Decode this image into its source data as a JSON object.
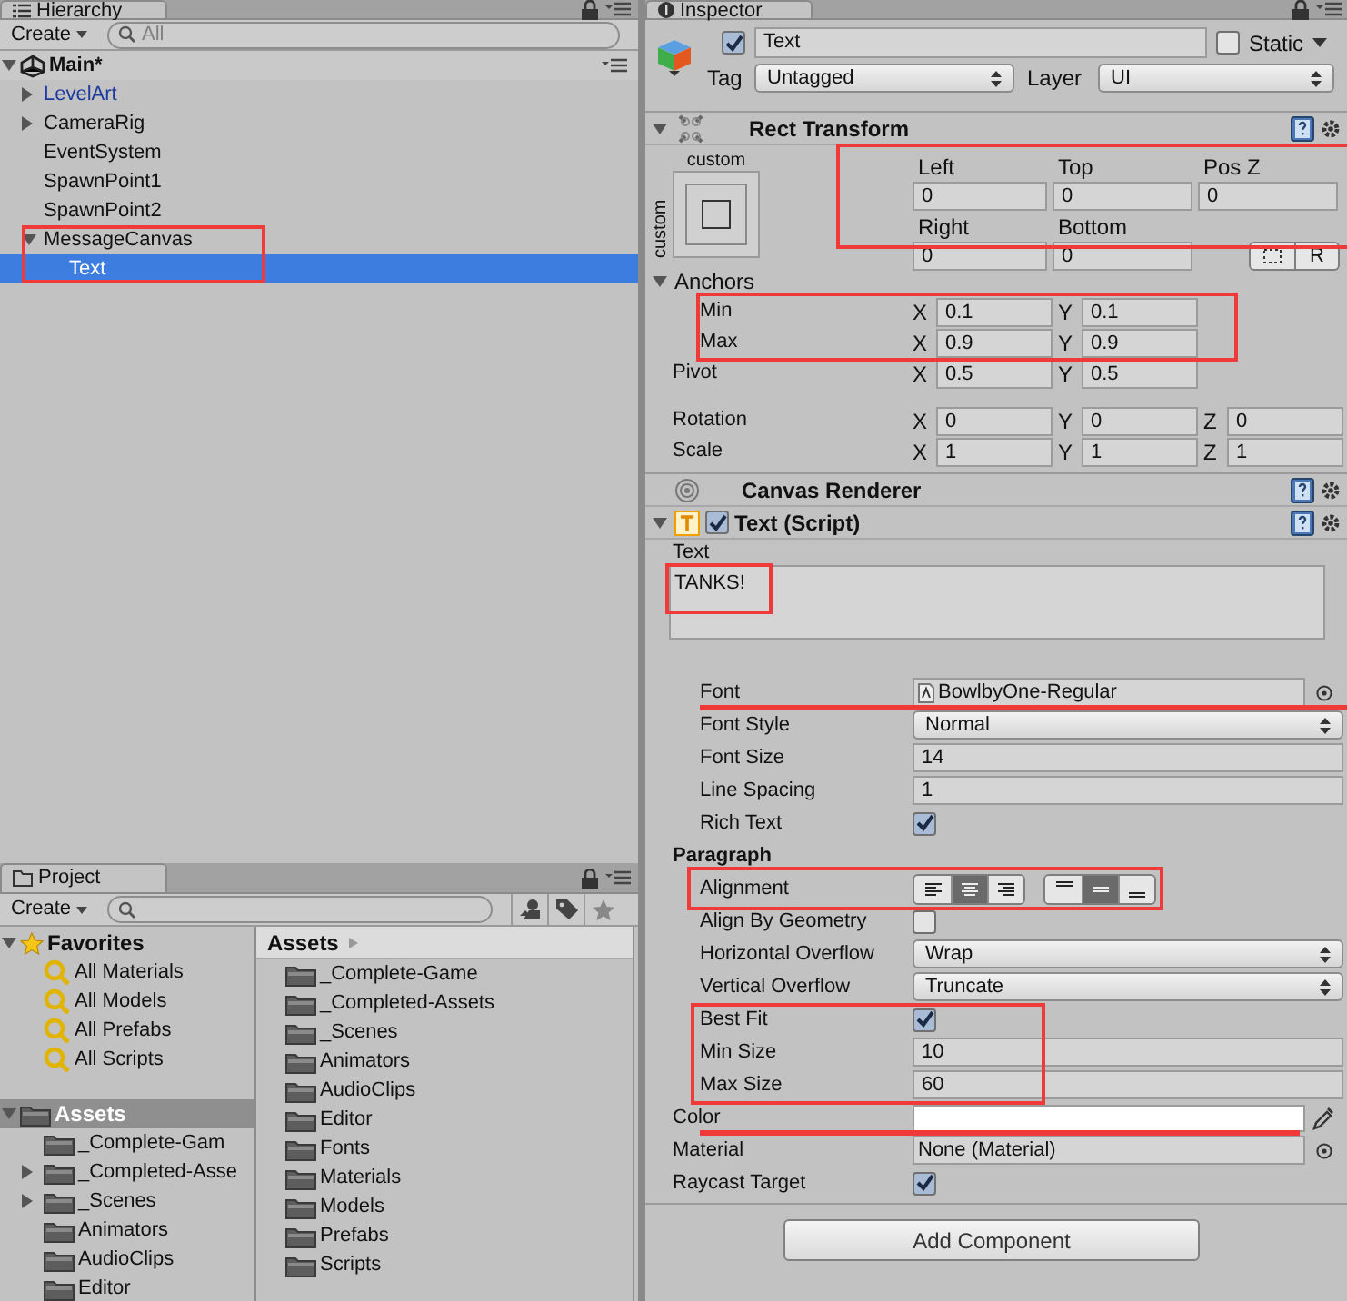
{
  "hierarchy": {
    "tab": "Hierarchy",
    "create": "Create",
    "search_placeholder": "All",
    "scene": {
      "name": "Main*",
      "expanded": true
    },
    "items": [
      {
        "label": "LevelArt",
        "prefab": true,
        "expanded": false,
        "selected": false
      },
      {
        "label": "CameraRig",
        "prefab": false,
        "expanded": false,
        "selected": false
      },
      {
        "label": "EventSystem",
        "prefab": false,
        "selected": false
      },
      {
        "label": "SpawnPoint1",
        "prefab": false,
        "selected": false
      },
      {
        "label": "SpawnPoint2",
        "prefab": false,
        "selected": false
      },
      {
        "label": "MessageCanvas",
        "prefab": false,
        "expanded": true,
        "selected": false,
        "highlighted": true,
        "children": [
          {
            "label": "Text",
            "prefab": false,
            "selected": true
          }
        ]
      }
    ]
  },
  "project": {
    "tab": "Project",
    "create": "Create",
    "favorites": {
      "label": "Favorites",
      "expanded": true,
      "items": [
        "All Materials",
        "All Models",
        "All Prefabs",
        "All Scripts"
      ]
    },
    "assets_tree": {
      "label": "Assets",
      "expanded": true,
      "selected": true,
      "children": [
        {
          "label": "_Complete-Gam"
        },
        {
          "label": "_Completed-Asse",
          "expanded": false
        },
        {
          "label": "_Scenes",
          "expanded": false
        },
        {
          "label": "Animators"
        },
        {
          "label": "AudioClips"
        },
        {
          "label": "Editor"
        }
      ]
    },
    "breadcrumb": "Assets",
    "folders": [
      "_Complete-Game",
      "_Completed-Assets",
      "_Scenes",
      "Animators",
      "AudioClips",
      "Editor",
      "Fonts",
      "Materials",
      "Models",
      "Prefabs",
      "Scripts"
    ]
  },
  "inspector": {
    "tab": "Inspector",
    "active": true,
    "name": "Text",
    "static": false,
    "static_label": "Static",
    "tag_label": "Tag",
    "tag": "Untagged",
    "layer_label": "Layer",
    "layer": "UI",
    "components": [
      {
        "kind": "rect_transform",
        "title": "Rect Transform",
        "expanded": true,
        "preset_label": "custom",
        "preset_side_label": "custom",
        "offsets": {
          "highlighted": true,
          "fields": [
            {
              "label": "Left",
              "value": "0"
            },
            {
              "label": "Top",
              "value": "0"
            },
            {
              "label": "Pos Z",
              "value": "0"
            },
            {
              "label": "Right",
              "value": "0"
            },
            {
              "label": "Bottom",
              "value": "0"
            }
          ]
        },
        "raw_button": "R",
        "anchors": {
          "label": "Anchors",
          "expanded": true,
          "highlighted": true,
          "rows": [
            {
              "label": "Min",
              "components": [
                {
                  "axis": "X",
                  "value": "0.1"
                },
                {
                  "axis": "Y",
                  "value": "0.1"
                }
              ]
            },
            {
              "label": "Max",
              "components": [
                {
                  "axis": "X",
                  "value": "0.9"
                },
                {
                  "axis": "Y",
                  "value": "0.9"
                }
              ]
            }
          ]
        },
        "vectors": [
          {
            "label": "Pivot",
            "components": [
              {
                "axis": "X",
                "value": "0.5"
              },
              {
                "axis": "Y",
                "value": "0.5"
              }
            ]
          },
          {
            "label": "Rotation",
            "components": [
              {
                "axis": "X",
                "value": "0"
              },
              {
                "axis": "Y",
                "value": "0"
              },
              {
                "axis": "Z",
                "value": "0"
              }
            ]
          },
          {
            "label": "Scale",
            "components": [
              {
                "axis": "X",
                "value": "1"
              },
              {
                "axis": "Y",
                "value": "1"
              },
              {
                "axis": "Z",
                "value": "1"
              }
            ]
          }
        ]
      },
      {
        "kind": "canvas_renderer",
        "title": "Canvas Renderer"
      },
      {
        "kind": "text_script",
        "title": "Text (Script)",
        "expanded": true,
        "enabled": true,
        "text_label": "Text",
        "text": "TANKS!",
        "text_highlighted": true,
        "character": [
          {
            "kind": "object",
            "label": "Font",
            "value": "BowlbyOne-Regular",
            "underlined": true
          },
          {
            "kind": "dropdown",
            "label": "Font Style",
            "value": "Normal"
          },
          {
            "kind": "field",
            "label": "Font Size",
            "value": "14"
          },
          {
            "kind": "field",
            "label": "Line Spacing",
            "value": "1"
          },
          {
            "kind": "checkbox",
            "label": "Rich Text",
            "checked": true
          }
        ],
        "paragraph": {
          "label": "Paragraph",
          "properties": [
            {
              "kind": "alignment",
              "label": "Alignment",
              "highlighted": true,
              "horizontal": [
                {
                  "selected": false
                },
                {
                  "selected": true
                },
                {
                  "selected": false
                }
              ],
              "vertical": [
                {
                  "selected": false
                },
                {
                  "selected": true
                },
                {
                  "selected": false
                }
              ]
            },
            {
              "kind": "checkbox",
              "label": "Align By Geometry",
              "checked": false
            },
            {
              "kind": "dropdown",
              "label": "Horizontal Overflow",
              "value": "Wrap"
            },
            {
              "kind": "dropdown",
              "label": "Vertical Overflow",
              "value": "Truncate"
            },
            {
              "kind": "checkbox",
              "label": "Best Fit",
              "checked": true,
              "highlighted": true
            },
            {
              "kind": "field",
              "label": "Min Size",
              "value": "10",
              "highlighted": true
            },
            {
              "kind": "field",
              "label": "Max Size",
              "value": "60",
              "highlighted": true
            }
          ]
        },
        "properties": [
          {
            "kind": "color",
            "label": "Color",
            "color": "#ffffff",
            "underlined": true
          },
          {
            "kind": "object",
            "label": "Material",
            "value": "None (Material)"
          },
          {
            "kind": "checkbox",
            "label": "Raycast Target",
            "checked": true
          }
        ]
      }
    ],
    "add_button": "Add Component"
  }
}
